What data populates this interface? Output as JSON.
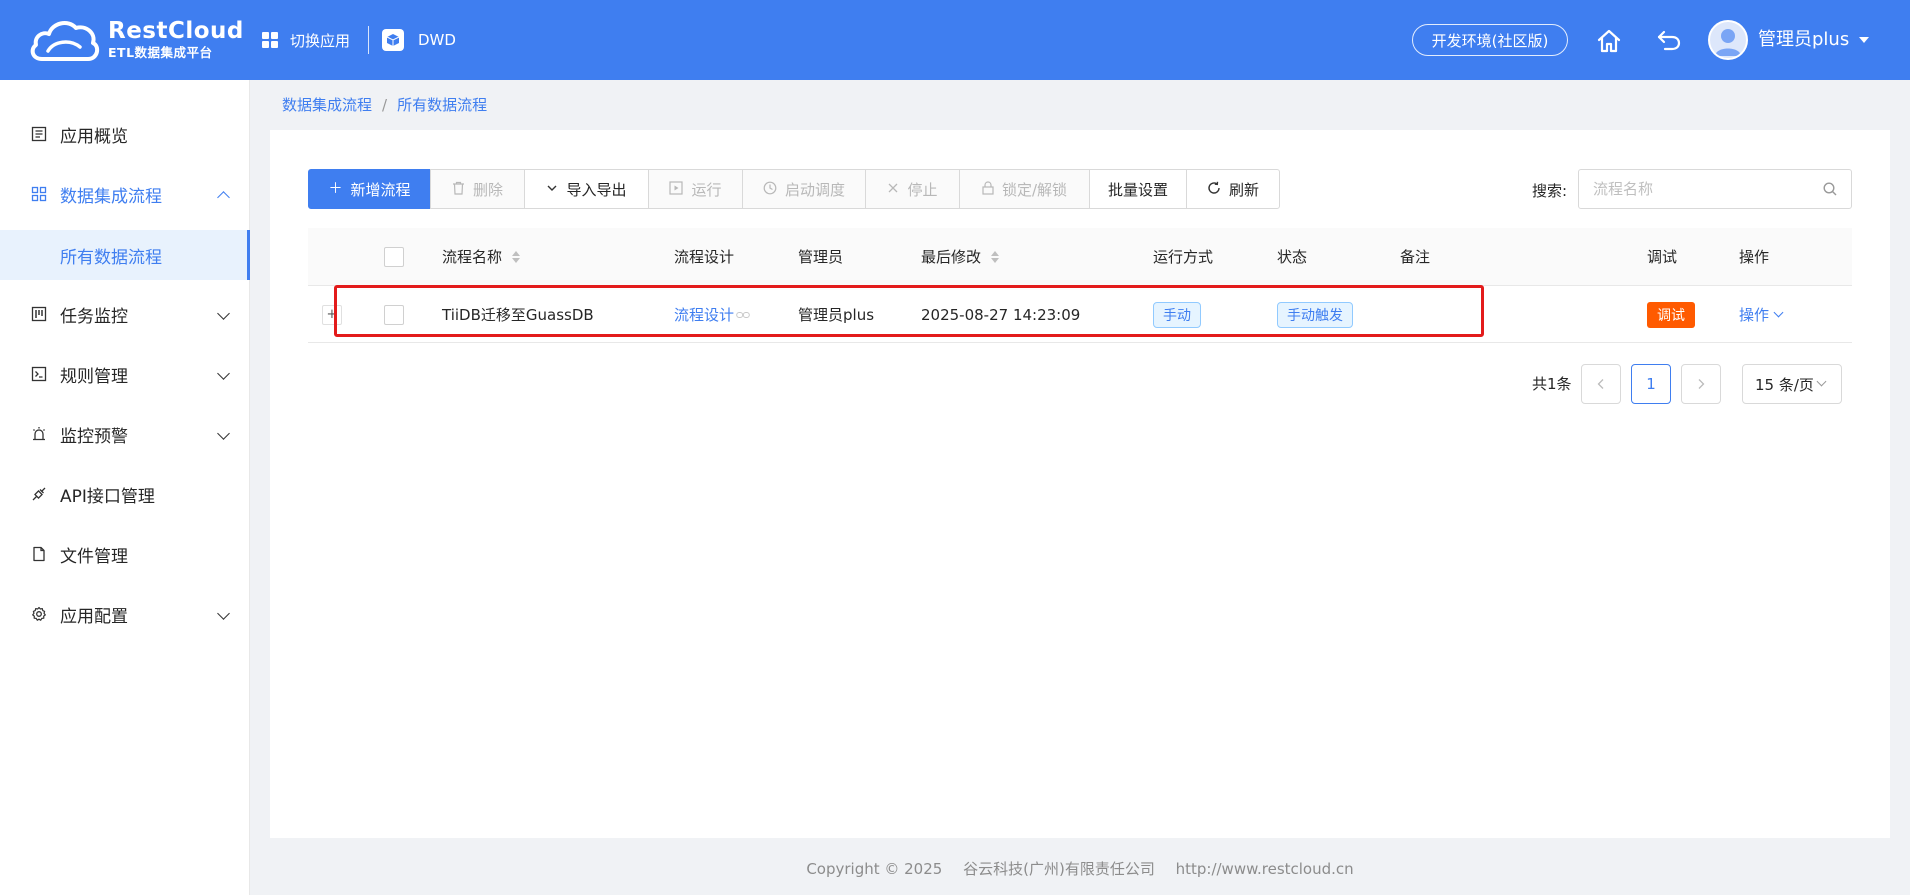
{
  "header": {
    "logo_name": "RestCloud",
    "logo_sub": "ETL数据集成平台",
    "switch_app": "切换应用",
    "current_app": "DWD",
    "env_badge": "开发环境(社区版)",
    "user_name": "管理员plus",
    "brand_color": "#3f7ef0"
  },
  "sidebar": {
    "items": [
      {
        "label": "应用概览",
        "icon": "list-doc-icon"
      },
      {
        "label": "数据集成流程",
        "icon": "grid-icon",
        "active": true
      },
      {
        "label": "所有数据流程",
        "sub": true
      },
      {
        "label": "任务监控",
        "icon": "kanban-icon"
      },
      {
        "label": "规则管理",
        "icon": "terminal-icon"
      },
      {
        "label": "监控预警",
        "icon": "alarm-icon"
      },
      {
        "label": "API接口管理",
        "icon": "api-plug-icon"
      },
      {
        "label": "文件管理",
        "icon": "file-icon"
      },
      {
        "label": "应用配置",
        "icon": "gear-icon"
      }
    ]
  },
  "breadcrumb": [
    "数据集成流程",
    "所有数据流程"
  ],
  "toolbar": {
    "add": "新增流程",
    "delete": "删除",
    "import_export": "导入导出",
    "run": "运行",
    "start_schedule": "启动调度",
    "stop": "停止",
    "lock_unlock": "锁定/解锁",
    "batch_settings": "批量设置",
    "refresh": "刷新"
  },
  "search": {
    "label": "搜索:",
    "placeholder": "流程名称"
  },
  "table": {
    "columns": [
      "流程名称",
      "流程设计",
      "管理员",
      "最后修改",
      "运行方式",
      "状态",
      "备注",
      "调试",
      "操作"
    ],
    "rows": [
      {
        "name": "TiiDB迁移至GuassDB",
        "design": "流程设计",
        "admin": "管理员plus",
        "modified": "2025-08-27 14:23:09",
        "run_mode": "手动",
        "status": "手动触发",
        "remark": "",
        "debug": "调试",
        "action": "操作"
      }
    ]
  },
  "pagination": {
    "total": "共1条",
    "current_page": "1",
    "page_size": "15 条/页"
  },
  "footer": {
    "copyright": "Copyright © 2025",
    "company": "谷云科技(广州)有限责任公司",
    "url": "http://www.restcloud.cn"
  }
}
